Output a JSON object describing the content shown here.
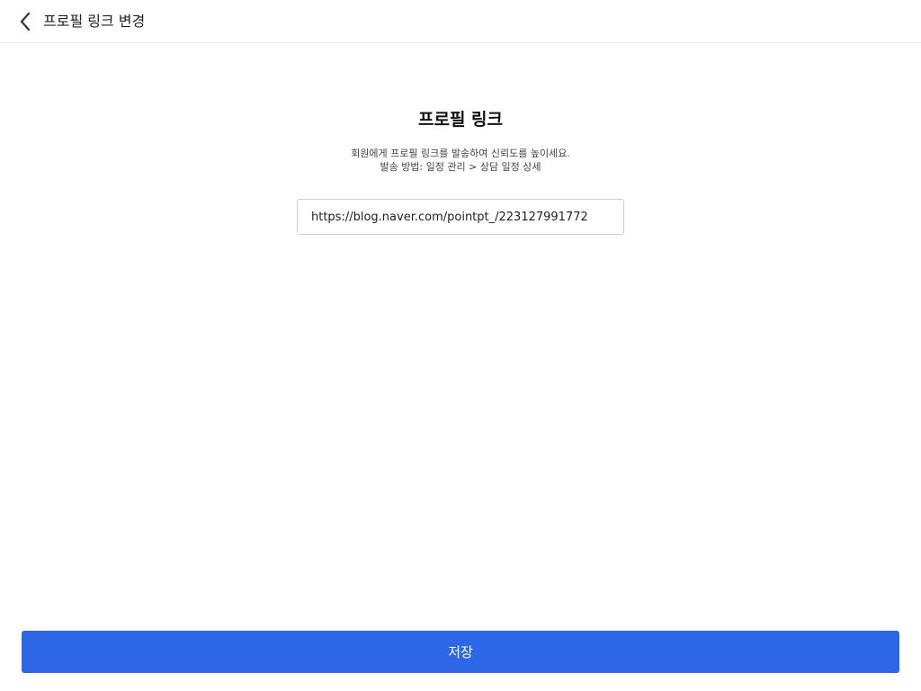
{
  "header": {
    "back_icon": "chevron-left-icon",
    "title": "프로필 링크 변경"
  },
  "main": {
    "section_title": "프로필 링크",
    "description_line1": "회원에게 프로필 링크를 발송하여 신뢰도를 높이세요.",
    "description_line2": "발송 방법: 일정 관리 > 상담 일정 상세",
    "link_input_value": "https://blog.naver.com/pointpt_/223127991772"
  },
  "footer": {
    "save_label": "저장"
  },
  "colors": {
    "accent": "#2e66e8",
    "text": "#222222",
    "divider": "#e6e6e6"
  }
}
